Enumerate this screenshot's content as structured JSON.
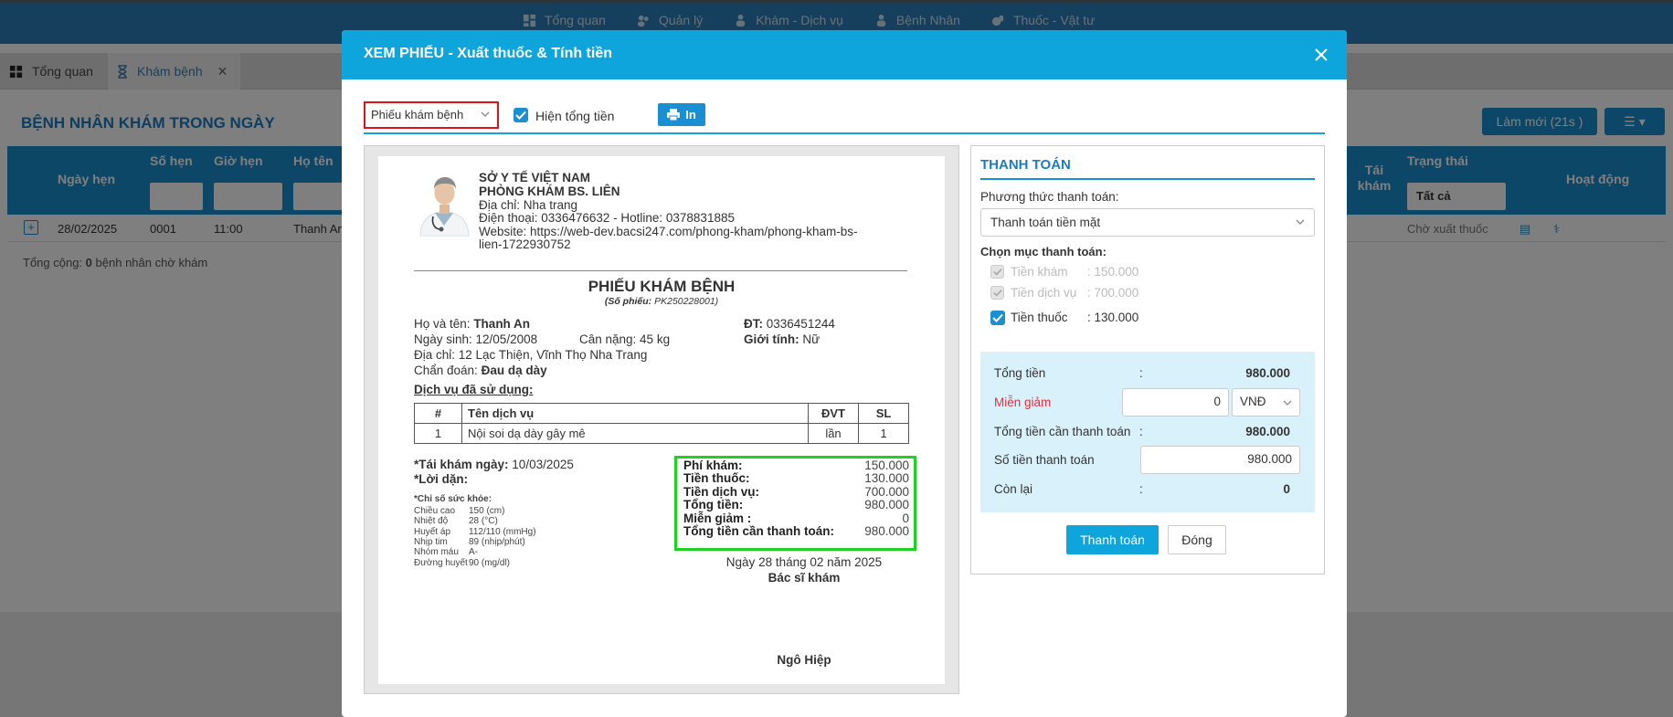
{
  "nav": {
    "items": [
      "Tổng quan",
      "Quản lý",
      "Khám - Dịch vụ",
      "Bệnh Nhân",
      "Thuốc - Vật tư"
    ]
  },
  "tabs": {
    "overview": "Tổng quan",
    "exam": "Khám bệnh"
  },
  "background": {
    "title": "BỆNH NHÂN KHÁM TRONG NGÀY",
    "refresh_label": "Làm mới (21s )",
    "columns": {
      "date": "Ngày hẹn",
      "number": "Số hẹn",
      "time": "Giờ hẹn",
      "name": "Họ tên",
      "revisit": "Tái khám",
      "status": "Trạng thái",
      "actions": "Hoạt động"
    },
    "status_filter": "Tất cả",
    "row": {
      "date": "28/02/2025",
      "number": "0001",
      "time": "11:00",
      "name": "Thanh An",
      "status": "Chờ xuất thuốc"
    },
    "total_prefix": "Tổng cộng:",
    "total_count": "0",
    "total_suffix": "bệnh nhân chờ khám"
  },
  "modal": {
    "title": "XEM PHIẾU - Xuất thuốc & Tính tiền",
    "form_select": "Phiếu khám bệnh",
    "show_total_label": "Hiện tổng tiền",
    "print_label": "In",
    "doc": {
      "org1": "SỞ Y TẾ VIỆT NAM",
      "org2": "PHÒNG KHÁM BS. LIÊN",
      "address": "Địa chỉ: Nha trang",
      "phone": "Điện thoại: 0336476632 - Hotline: 0378831885",
      "website1": "Website: https://web-dev.bacsi247.com/phong-kham/phong-kham-bs-",
      "website2": "lien-1722930752",
      "title": "PHIẾU KHÁM BỆNH",
      "code_label": "(Số phiếu:",
      "code_value": "PK250228001)",
      "name_label": "Họ và tên:",
      "name_value": "Thanh An",
      "phone_label": "ĐT:",
      "phone_value": "0336451244",
      "dob": "Ngày sinh: 12/05/2008",
      "weight": "Cân nặng: 45 kg",
      "gender_label": "Giới tính:",
      "gender_value": "Nữ",
      "addr_patient": "Địa chỉ: 12 Lạc Thiện, Vĩnh Thọ Nha Trang",
      "diag_label": "Chẩn đoán:",
      "diag_value": "Đau dạ dày",
      "services_heading": "Dịch vụ đã sử dụng:",
      "table_headers": [
        "#",
        "Tên dịch vụ",
        "ĐVT",
        "SL"
      ],
      "table_rows": [
        [
          "1",
          "Nội soi dạ dày gây mê",
          "lần",
          "1"
        ]
      ],
      "revisit_label": "*Tái khám ngày:",
      "revisit_value": "10/03/2025",
      "advice_label": "*Lời dặn:",
      "vitals_heading": "*Chỉ số sức khỏe:",
      "vitals": [
        [
          "Chiều cao",
          "150 (cm)"
        ],
        [
          "Nhiệt độ",
          "28 (°C)"
        ],
        [
          "Huyết áp",
          "112/110 (mmHg)"
        ],
        [
          "Nhịp tim",
          "89 (nhịp/phút)"
        ],
        [
          "Nhóm máu",
          "A-"
        ],
        [
          "Đường huyết",
          "90 (mg/dl)"
        ]
      ],
      "fees": [
        [
          "Phí khám:",
          "150.000"
        ],
        [
          "Tiền thuốc:",
          "130.000"
        ],
        [
          "Tiền dịch vụ:",
          "700.000"
        ],
        [
          "Tổng tiền:",
          "980.000"
        ],
        [
          "Miễn giảm :",
          "0"
        ],
        [
          "Tổng tiền cần thanh toán:",
          "980.000"
        ]
      ],
      "date_line": "Ngày 28 tháng 02 năm 2025",
      "doctor_title": "Bác sĩ khám",
      "doctor_name": "Ngô Hiệp"
    },
    "payment": {
      "title": "THANH TOÁN",
      "method_label": "Phương thức thanh toán:",
      "method_value": "Thanh toán tiền mặt",
      "items_label": "Chọn mục thanh toán:",
      "items": [
        [
          "Tiền khám",
          ": 150.000"
        ],
        [
          "Tiền dịch vụ",
          ": 700.000"
        ],
        [
          "Tiền thuốc",
          ": 130.000"
        ]
      ],
      "total_label": "Tổng tiền",
      "total_value": "980.000",
      "discount_label": "Miễn giảm",
      "discount_value": "0",
      "discount_unit": "VNĐ",
      "need_label": "Tổng tiền cần thanh toán",
      "need_value": "980.000",
      "paid_label": "Số tiền thanh toán",
      "paid_value": "980.000",
      "remain_label": "Còn lại",
      "remain_value": "0",
      "colon": ":",
      "pay_button": "Thanh toán",
      "close_button": "Đóng"
    }
  },
  "colors": {
    "accent": "#0ea5dd",
    "discount": "#e0303c",
    "highlight": "#21d121",
    "select_border": "#e0101c"
  }
}
